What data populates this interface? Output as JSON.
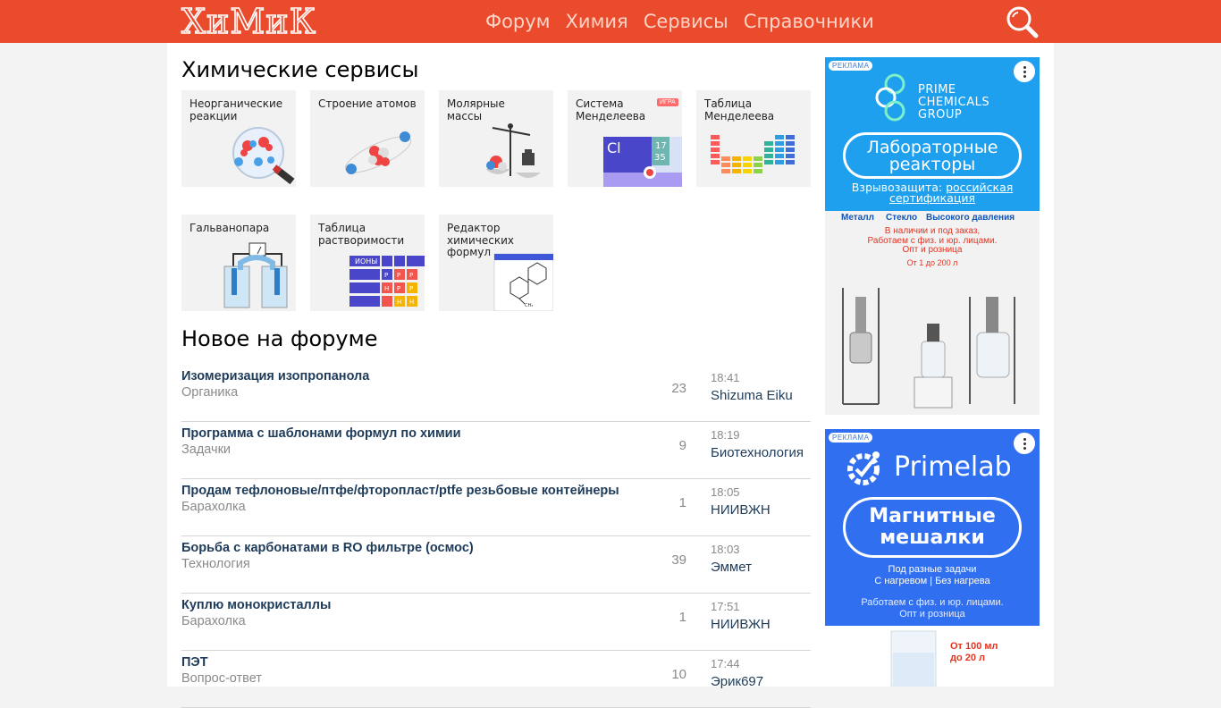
{
  "header": {
    "logo": "ХиМиК",
    "nav": [
      "Форум",
      "Химия",
      "Сервисы",
      "Справочники"
    ]
  },
  "services": {
    "title": "Химические сервисы",
    "cards": [
      {
        "label": "Неорганические\nреакции"
      },
      {
        "label": "Строение атомов"
      },
      {
        "label": "Молярные\nмассы"
      },
      {
        "label": "Система\nМенделеева",
        "tag": "ИГРА",
        "el_symbol": "Cl",
        "el_n1": "17",
        "el_n2": "35"
      },
      {
        "label": "Таблица\nМенделеева"
      },
      {
        "label": "Гальванопара"
      },
      {
        "label": "Таблица\nрастворимости",
        "ions": "ИОНЫ",
        "cells": [
          "Р",
          "Р",
          "Р",
          "Н",
          "Р",
          "Р",
          "Н",
          "Н"
        ]
      },
      {
        "label": "Редактор\nхимических\nформул",
        "ch3": "CH₃"
      }
    ]
  },
  "forum": {
    "title": "Новое на форуме",
    "topics": [
      {
        "title": "Изомеризация изопропанола",
        "category": "Органика",
        "count": "23",
        "time": "18:41",
        "user": "Shizuma Eiku"
      },
      {
        "title": "Программа с шаблонами формул по химии",
        "category": "Задачки",
        "count": "9",
        "time": "18:19",
        "user": "Биотехнология"
      },
      {
        "title": "Продам тефлоновые/птфе/фторопласт/ptfe резьбовые контейнеры",
        "category": "Барахолка",
        "count": "1",
        "time": "18:05",
        "user": "НИИВЖН"
      },
      {
        "title": "Борьба с карбонатами в RO фильтре (осмос)",
        "category": "Технология",
        "count": "39",
        "time": "18:03",
        "user": "Эммет"
      },
      {
        "title": "Куплю монокристаллы",
        "category": "Барахолка",
        "count": "1",
        "time": "17:51",
        "user": "НИИВЖН"
      },
      {
        "title": "ПЭТ",
        "category": "Вопрос-ответ",
        "count": "10",
        "time": "17:44",
        "user": "Эрик697"
      }
    ]
  },
  "ad1": {
    "tag": "РЕКЛАМА",
    "brand": "PRIME\nCHEMICALS\nGROUP",
    "headline": "Лабораторные\nреакторы",
    "sub_prefix": "Взрывозащита: ",
    "sub_link": "российская\nсертификация",
    "features": [
      "Металл",
      "Стекло",
      "Высокого давления"
    ],
    "red1": "В наличии и под заказ,",
    "red2": "Работаем с физ. и юр. лицами.",
    "red3": "Опт и розница",
    "volume": "От 1 до 200 л"
  },
  "ad2": {
    "tag": "РЕКЛАМА",
    "brand": "Primelab",
    "headline": "Магнитные\nмешалки",
    "line1": "Под разные задачи",
    "line2": "С нагревом | Без нагрева",
    "line3": "Работаем с физ. и юр. лицами.",
    "line4": "Опт и розница",
    "volume": "От 100 мл\nдо 20 л"
  },
  "colors": {
    "brand": "#e94b2c",
    "ad1_bg": "#1ea0ef",
    "ad2_bg": "#2f6ff0",
    "link": "#1e3b5a",
    "muted": "#8a8a8a"
  }
}
